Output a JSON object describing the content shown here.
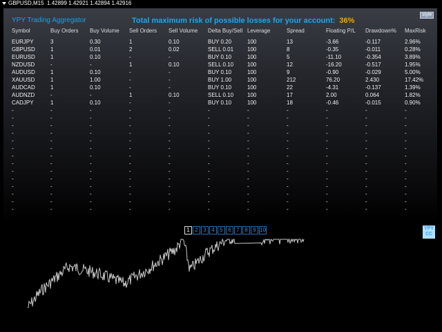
{
  "topbar": {
    "symbol": "GBPUSD,M15",
    "prices": "1.42899 1.42921 1.42894 1.42916"
  },
  "panel": {
    "title": "YPY Trading Aggregator",
    "risk_label": "Total maximum risk of possible losses for your account:",
    "risk_value": "36%",
    "style_button": "style"
  },
  "columns": [
    "Symbol",
    "Buy Orders",
    "Buy Volume",
    "Sell Orders",
    "Sell Volume",
    "Delta Buy/Sell",
    "Leverage",
    "Spread",
    "Floating P/L",
    "Drawdown%",
    "MaxRisk"
  ],
  "rows": [
    [
      "EURJPY",
      "3",
      "0.30",
      "1",
      "0.10",
      "BUY 0.20",
      "100",
      "13",
      "-3.66",
      "-0.117",
      "2.96%"
    ],
    [
      "GBPUSD",
      "1",
      "0.01",
      "2",
      "0.02",
      "SELL 0.01",
      "100",
      "8",
      "-0.35",
      "-0.011",
      "0.28%"
    ],
    [
      "EURUSD",
      "1",
      "0.10",
      "-",
      "-",
      "BUY 0.10",
      "100",
      "5",
      "-11.10",
      "-0.354",
      "3.89%"
    ],
    [
      "NZDUSD",
      "-",
      "-",
      "1",
      "0.10",
      "SELL 0.10",
      "100",
      "12",
      "-16.20",
      "-0.517",
      "1.95%"
    ],
    [
      "AUDUSD",
      "1",
      "0.10",
      "-",
      "-",
      "BUY 0.10",
      "100",
      "9",
      "-0.90",
      "-0.029",
      "5.00%"
    ],
    [
      "XAUUSD",
      "1",
      "1.00",
      "-",
      "-",
      "BUY 1.00",
      "100",
      "212",
      "76.20",
      "2.430",
      "17.42%"
    ],
    [
      "AUDCAD",
      "1",
      "0.10",
      "-",
      "-",
      "BUY 0.10",
      "100",
      "22",
      "-4.31",
      "-0.137",
      "1.39%"
    ],
    [
      "AUDNZD",
      "-",
      "-",
      "1",
      "0.10",
      "SELL 0.10",
      "100",
      "17",
      "2.00",
      "0.064",
      "1.82%"
    ],
    [
      "CADJPY",
      "1",
      "0.10",
      "-",
      "-",
      "BUY 0.10",
      "100",
      "18",
      "-0.46",
      "-0.015",
      "0.90%"
    ]
  ],
  "empty_row_count": 14,
  "empty_cell": "-",
  "pages": [
    "1",
    "2",
    "3",
    "4",
    "5",
    "6",
    "7",
    "8",
    "9",
    "10"
  ],
  "active_page": "1",
  "logo": [
    "YPY",
    "CC"
  ]
}
